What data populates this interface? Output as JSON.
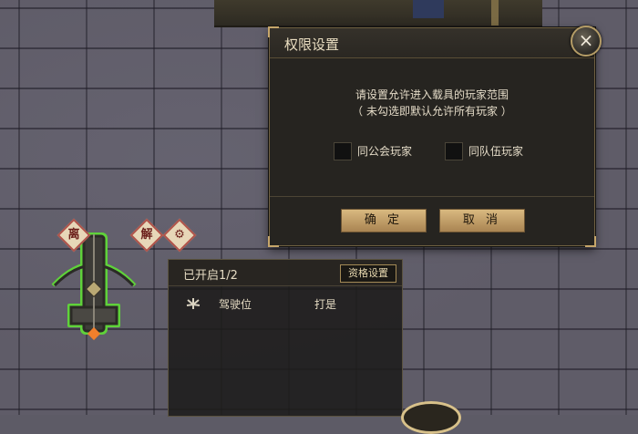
{
  "dialog": {
    "title": "权限设置",
    "close_icon": "×",
    "prompt_line1": "请设置允许进入载具的玩家范围",
    "prompt_line2": "（ 未勾选即默认允许所有玩家 ）",
    "checkboxes": [
      {
        "label": "同公会玩家",
        "checked": false
      },
      {
        "label": "同队伍玩家",
        "checked": false
      }
    ],
    "confirm_label": "确 定",
    "cancel_label": "取 消"
  },
  "seat_panel": {
    "count_label": "已开启1/2",
    "qualification_button": "资格设置",
    "seats": [
      {
        "icon": "wheel-icon",
        "label": "驾驶位",
        "player": "打是"
      }
    ]
  },
  "side_buttons": {
    "leave": "离",
    "release": "解"
  },
  "colors": {
    "accent_gold": "#d9b980",
    "dialog_bg": "#262420",
    "vehicle_outline": "#5fd23a"
  }
}
